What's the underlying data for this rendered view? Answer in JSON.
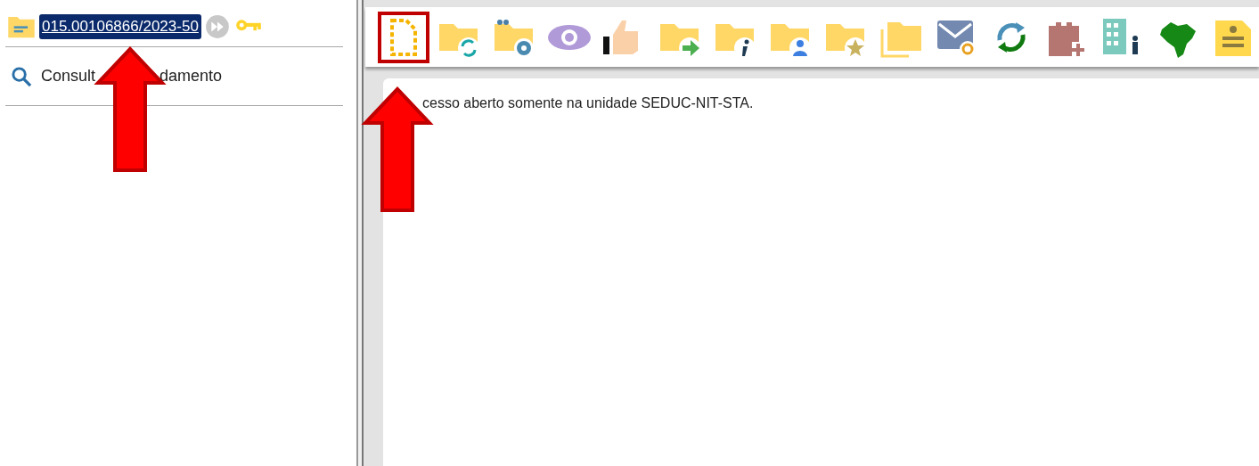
{
  "process": {
    "number": "015.00106866/2023-50"
  },
  "menu": [
    {
      "label_start": "Consult",
      "label_end": "damento"
    }
  ],
  "toolbar_buttons": [
    {
      "kind": "new-document",
      "highlighted": true
    },
    {
      "kind": "folder-sync",
      "highlighted": false
    },
    {
      "kind": "folder-people",
      "highlighted": false
    },
    {
      "kind": "eye",
      "highlighted": false
    },
    {
      "kind": "thumb",
      "highlighted": false
    },
    {
      "kind": "folder-send",
      "highlighted": false
    },
    {
      "kind": "folder-info",
      "highlighted": false
    },
    {
      "kind": "folder-user",
      "highlighted": false
    },
    {
      "kind": "folder-star",
      "highlighted": false
    },
    {
      "kind": "folders",
      "highlighted": false
    },
    {
      "kind": "mail",
      "highlighted": false
    },
    {
      "kind": "refresh",
      "highlighted": false
    },
    {
      "kind": "blocks-add",
      "highlighted": false
    },
    {
      "kind": "building",
      "highlighted": false
    },
    {
      "kind": "map",
      "highlighted": false
    },
    {
      "kind": "note",
      "highlighted": false
    }
  ],
  "message": "cesso aberto somente na unidade SEDUC-NIT-STA.",
  "annotations": [
    {
      "kind": "arrow"
    },
    {
      "kind": "arrow"
    }
  ]
}
